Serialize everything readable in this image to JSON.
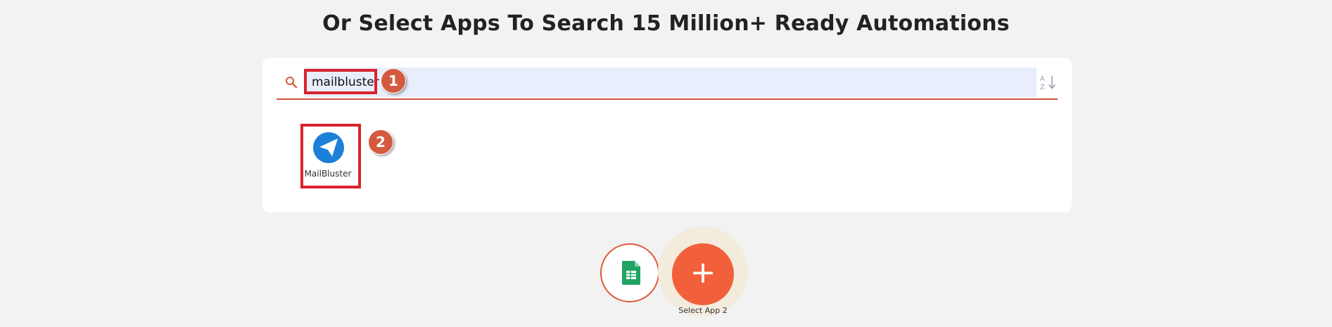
{
  "heading": "Or Select Apps To Search 15 Million+ Ready Automations",
  "search": {
    "value": "mailbluster",
    "placeholder": "",
    "icon": "search-icon",
    "sort_icon": "sort-alpha-icon"
  },
  "steps": {
    "one": "1",
    "two": "2"
  },
  "results": [
    {
      "label": "MailBluster",
      "icon": "mailbluster-logo-icon"
    }
  ],
  "workflow": {
    "app1_icon": "google-sheets-icon",
    "add_symbol": "+",
    "add_label": "Select App 2"
  },
  "colors": {
    "accent": "#f2603b",
    "highlight": "#d9232d",
    "badge": "#d45a3f",
    "search_fill": "#e8eefb",
    "mailbluster_blue": "#1c7fd8",
    "sheets_green": "#1fa463"
  }
}
